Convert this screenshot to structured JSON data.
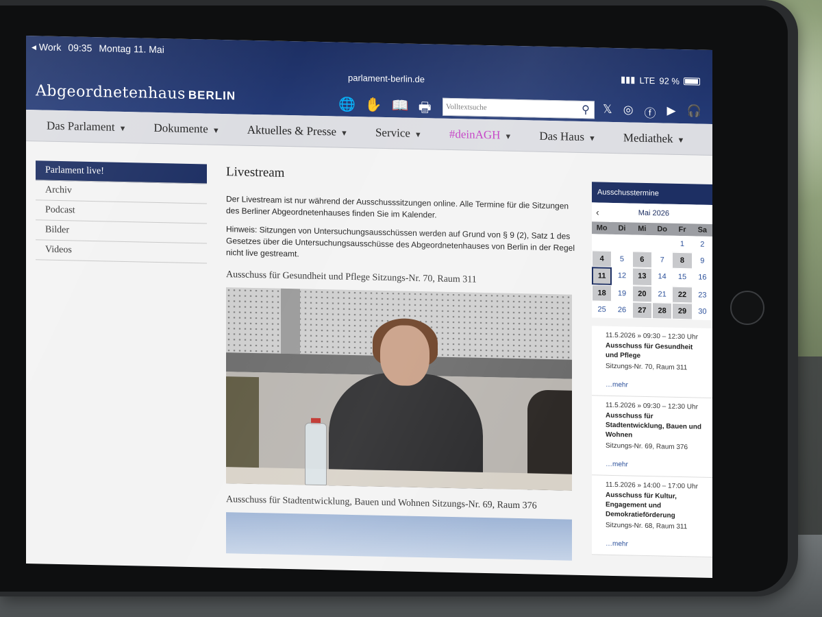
{
  "status": {
    "back_label": "◂ Work",
    "time": "09:35",
    "date": "Montag 11. Mai",
    "signal": "LTE",
    "battery": "92 %"
  },
  "browser": {
    "url": "parlament-berlin.de"
  },
  "header": {
    "logo_main": "Abgeordnetenhaus",
    "logo_city": "BERLIN",
    "search_placeholder": "Volltextsuche",
    "icons": [
      "globe-icon",
      "sign-language-icon",
      "easy-read-icon",
      "print-icon"
    ],
    "social": [
      "x-icon",
      "instagram-icon",
      "facebook-icon",
      "youtube-icon",
      "podcast-icon"
    ]
  },
  "nav": {
    "items": [
      {
        "label": "Das Parlament"
      },
      {
        "label": "Dokumente"
      },
      {
        "label": "Aktuelles & Presse"
      },
      {
        "label": "Service"
      },
      {
        "label": "#deinAGH"
      },
      {
        "label": "Das Haus"
      },
      {
        "label": "Mediathek"
      }
    ]
  },
  "sidebar": {
    "items": [
      {
        "label": "Parlament live!"
      },
      {
        "label": "Archiv"
      },
      {
        "label": "Podcast"
      },
      {
        "label": "Bilder"
      },
      {
        "label": "Videos"
      }
    ]
  },
  "main": {
    "title": "Livestream",
    "intro": "Der Livestream ist nur während der Ausschusssitzungen online. Alle Termine für die Sitzungen des Berliner Abgeordnetenhauses finden Sie im Kalender.",
    "hint": "Hinweis: Sitzungen von Untersuchungsausschüssen werden auf Grund von § 9 (2), Satz 1 des Gesetzes über die Untersuchungsausschüsse des Abgeordnetenhauses von Berlin in der Regel nicht live gestreamt.",
    "stream1_title": "Ausschuss für Gesundheit und Pflege Sitzungs-Nr. 70, Raum 311",
    "stream2_title": "Ausschuss für Stadtentwicklung, Bauen und Wohnen Sitzungs-Nr. 69, Raum 376"
  },
  "calendar": {
    "heading": "Ausschusstermine",
    "prev": "‹",
    "month": "Mai 2026",
    "weekdays": [
      "Mo",
      "Di",
      "Mi",
      "Do",
      "Fr",
      "Sa"
    ],
    "weeks": [
      [
        "",
        "",
        "",
        "",
        "1",
        "2"
      ],
      [
        "4",
        "5",
        "6",
        "7",
        "8",
        "9"
      ],
      [
        "11",
        "12",
        "13",
        "14",
        "15",
        "16"
      ],
      [
        "18",
        "19",
        "20",
        "21",
        "22",
        "23"
      ],
      [
        "25",
        "26",
        "27",
        "28",
        "29",
        "30"
      ]
    ],
    "event_days": [
      "4",
      "6",
      "8",
      "11",
      "13",
      "18",
      "20",
      "22",
      "27",
      "28",
      "29"
    ],
    "today": "11"
  },
  "events": [
    {
      "time": "11.5.2026 » 09:30 – 12:30 Uhr",
      "name": "Ausschuss für Gesundheit und Pflege",
      "room": "Sitzungs-Nr. 70, Raum 311",
      "more": "…mehr"
    },
    {
      "time": "11.5.2026 » 09:30 – 12:30 Uhr",
      "name": "Ausschuss für Stadtentwicklung, Bauen und Wohnen",
      "room": "Sitzungs-Nr. 69, Raum 376",
      "more": "…mehr"
    },
    {
      "time": "11.5.2026 » 14:00 – 17:00 Uhr",
      "name": "Ausschuss für Kultur, Engagement und Demokratieförderung",
      "room": "Sitzungs-Nr. 68, Raum 311",
      "more": "…mehr"
    }
  ],
  "colors": {
    "brand_navy": "#1d2f63",
    "nav_bg": "#dcdde2",
    "accent_pink": "#c23ac4"
  }
}
